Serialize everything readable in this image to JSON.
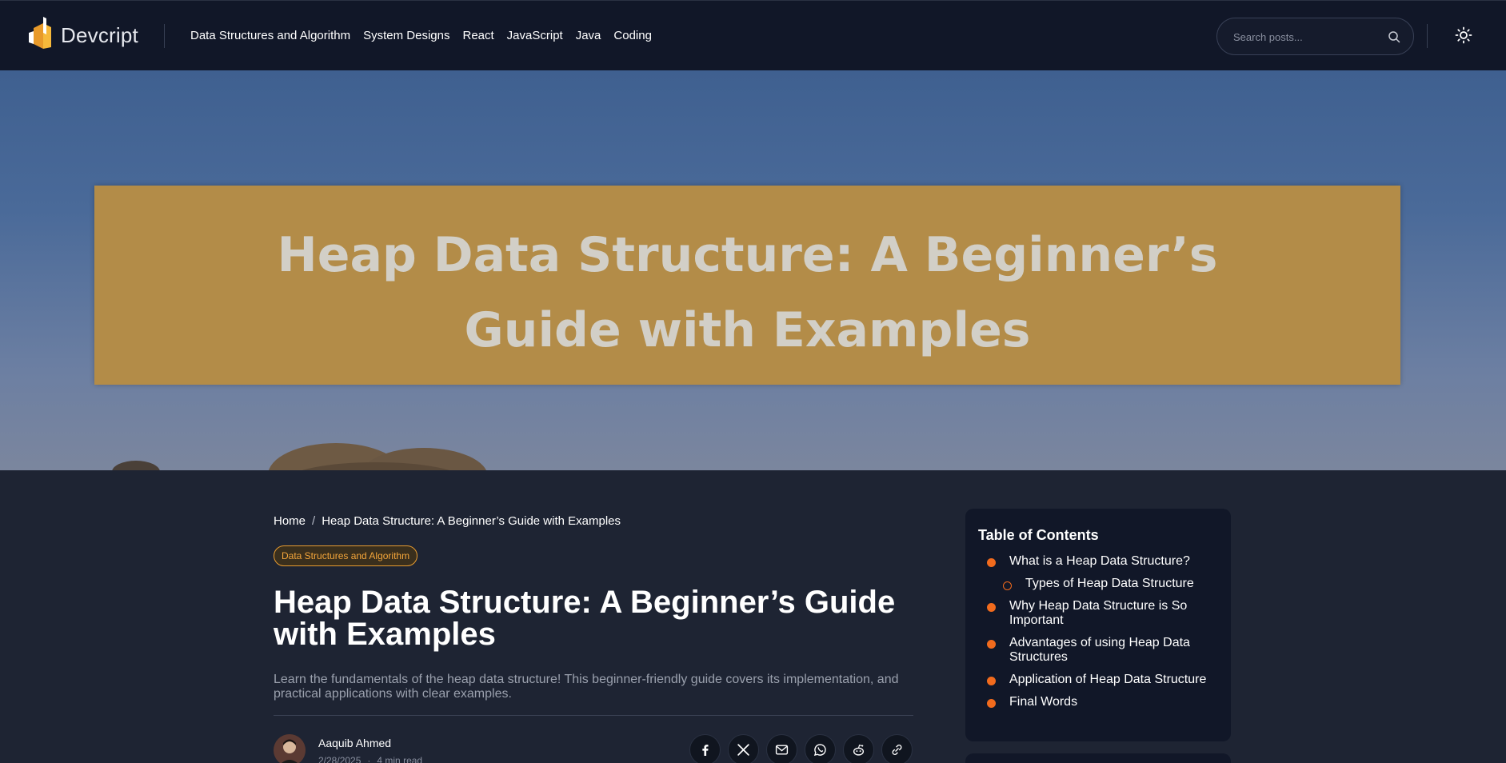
{
  "header": {
    "logo_text": "Devcript",
    "nav": [
      {
        "label": "Data Structures and Algorithm"
      },
      {
        "label": "System Designs"
      },
      {
        "label": "React"
      },
      {
        "label": "JavaScript"
      },
      {
        "label": "Java"
      },
      {
        "label": "Coding"
      }
    ],
    "search": {
      "placeholder": "Search posts...",
      "value": ""
    },
    "icons": {
      "search": "search-icon",
      "theme": "sun-icon"
    }
  },
  "hero": {
    "title_line1": "Heap Data Structure: A Beginner’s",
    "title_line2": "Guide with Examples"
  },
  "breadcrumb": {
    "home": "Home",
    "separator": "/",
    "current": "Heap Data Structure: A Beginner’s Guide with Examples"
  },
  "article": {
    "category": "Data Structures and Algorithm",
    "title": "Heap Data Structure: A Beginner’s Guide with Examples",
    "description": "Learn the fundamentals of the heap data structure! This beginner-friendly guide covers its implementation, and practical applications with clear examples.",
    "author": {
      "name": "Aaquib Ahmed",
      "date": "2/28/2025",
      "dot": "·",
      "read_time": "4 min read"
    }
  },
  "share": [
    {
      "name": "facebook-icon"
    },
    {
      "name": "x-icon"
    },
    {
      "name": "mail-icon"
    },
    {
      "name": "whatsapp-icon"
    },
    {
      "name": "reddit-icon"
    },
    {
      "name": "link-icon"
    }
  ],
  "toc": {
    "title": "Table of Contents",
    "items": [
      {
        "label": "What is a Heap Data Structure?",
        "sub": false
      },
      {
        "label": "Types of Heap Data Structure",
        "sub": true
      },
      {
        "label": "Why Heap Data Structure is So Important",
        "sub": false
      },
      {
        "label": "Advantages of using Heap Data Structures",
        "sub": false
      },
      {
        "label": "Application of Heap Data Structure",
        "sub": false
      },
      {
        "label": "Final Words",
        "sub": false
      }
    ]
  },
  "colors": {
    "page_bg": "#1e2433",
    "header_bg": "#111728",
    "accent": "#f26b1d",
    "badge": "#f3a53a",
    "banner": "#b38c48"
  }
}
